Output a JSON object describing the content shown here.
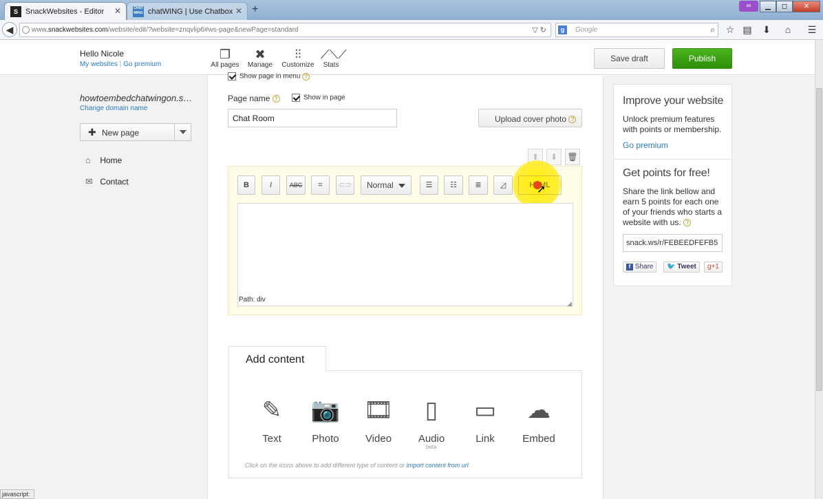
{
  "browser": {
    "tabs": [
      {
        "title": "SnackWebsites - Editor",
        "favicon": "S"
      },
      {
        "title": "chatWING | Use Chatbox",
        "favicon": "CHAT WING"
      }
    ],
    "url_prefix": "www.",
    "url_domain": "snackwebsites.com",
    "url_path": "/website/edit/?website=znqvlip6#ws-page&newPage=standard",
    "search_placeholder": "Google",
    "search_engine_icon": "g-icon"
  },
  "header": {
    "hello": "Hello Nicole",
    "my_websites": "My websites",
    "link_sep": "|",
    "go_premium": "Go premium",
    "tools": [
      {
        "label": "All pages",
        "icon": "pages-icon"
      },
      {
        "label": "Manage",
        "icon": "tools-icon"
      },
      {
        "label": "Customize",
        "icon": "sliders-icon"
      },
      {
        "label": "Stats",
        "icon": "chart-icon"
      }
    ],
    "save_draft": "Save draft",
    "publish": "Publish"
  },
  "left": {
    "site_name": "howtoembedchatwingon.s…",
    "change_domain": "Change domain name",
    "new_page": "New page",
    "nav": [
      {
        "label": "Home",
        "icon": "home-icon"
      },
      {
        "label": "Contact",
        "icon": "mail-icon"
      }
    ]
  },
  "page_settings": {
    "show_in_menu": "Show page in menu",
    "page_name_label": "Page name",
    "show_in_page": "Show in page",
    "page_name_value": "Chat Room",
    "upload_cover": "Upload cover photo"
  },
  "editor": {
    "toolbar": {
      "bold": "B",
      "italic": "I",
      "strike": "ABC",
      "format": "Normal",
      "html": "HTML"
    },
    "path": "Path: div"
  },
  "add_content": {
    "title": "Add content",
    "types": [
      {
        "label": "Text",
        "icon": "text-icon"
      },
      {
        "label": "Photo",
        "icon": "camera-icon"
      },
      {
        "label": "Video",
        "icon": "film-icon"
      },
      {
        "label": "Audio",
        "icon": "audio-icon",
        "badge": "beta"
      },
      {
        "label": "Link",
        "icon": "link-icon"
      },
      {
        "label": "Embed",
        "icon": "cloud-icon"
      }
    ],
    "hint": "Click on the icons above to add different type of content or",
    "hint_link": "import content from url"
  },
  "right": {
    "improve_title": "Improve your website",
    "improve_text": "Unlock premium features with points or membership.",
    "go_premium": "Go premium",
    "points_title": "Get points for free!",
    "points_text": "Share the link bellow and earn 5 points for each one of your friends who starts a website with us.",
    "referral": "snack.ws/r/FEBEEDFEFB5",
    "share": "Share",
    "tweet": "Tweet",
    "gplus": "+1"
  },
  "status": "javascript:"
}
